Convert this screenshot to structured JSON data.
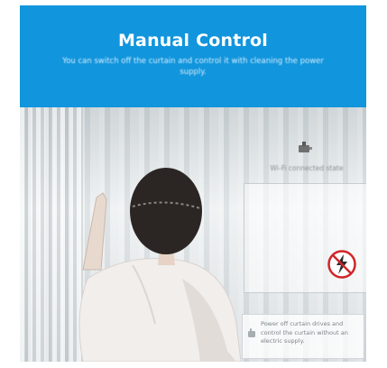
{
  "banner": {
    "title": "Manual Control",
    "subtitle": "You can switch off the curtain and control it with cleaning the power supply."
  },
  "photo": {
    "device_label": "Wi-Fi connected state",
    "note_text": "Power off curtain drives and control the curtain without an electric supply."
  },
  "colors": {
    "banner": "#1195dc",
    "no_power_red": "#d0252a"
  },
  "icons": {
    "device": "motor-device-icon",
    "no_power": "no-power-icon",
    "note": "hand-icon"
  }
}
